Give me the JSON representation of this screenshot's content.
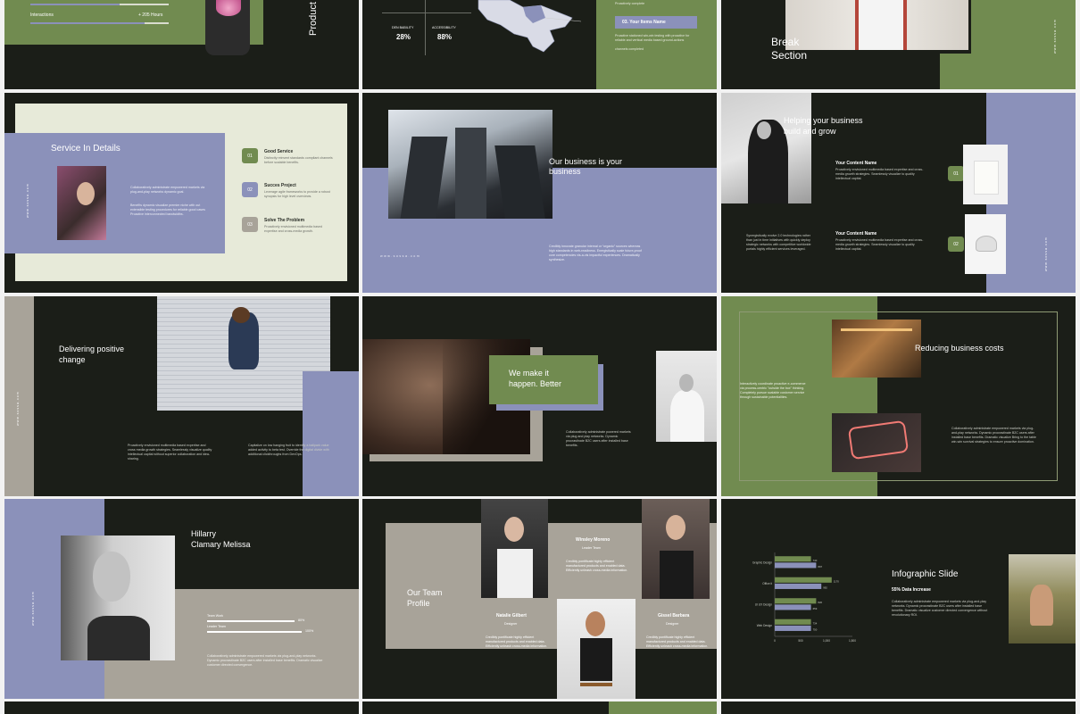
{
  "colors": {
    "dark": "#1b1e18",
    "green": "#718b50",
    "lavender": "#8b91ba",
    "taupe": "#a8a399",
    "cream": "#e7ead9"
  },
  "slide1": {
    "label": "Interactions",
    "value": "+ 205 Hours",
    "vertical": "Product"
  },
  "slide2": {
    "stats": [
      {
        "label": "DEN BABILITY",
        "value": "28%"
      },
      {
        "label": "ACCESSIBILITY",
        "value": "88%"
      }
    ],
    "tag": "03. Your Items Name",
    "text_a": "Proactively complete",
    "text_b": "Proactive stationed win-win testing with proactive for reliable and vertical media based ground-actions",
    "text_c": "channels completed"
  },
  "slide3": {
    "title": "Break\nSection",
    "side": "www.sossa.com"
  },
  "slide4": {
    "title": "Service In Details",
    "side": "www.sossa.com",
    "body1": "Collaboratively administrate empowered markets via plug-and-play networks dynamic goal.",
    "body2": "Benefits dynamic visualize premier niche with out extensible testing procedures for reliable good cases Proactive interconnected bandwidths.",
    "items": [
      {
        "num": "01",
        "title": "Good Service",
        "text": "Distinctly reinvent standards compliant channels before scalable benefits."
      },
      {
        "num": "02",
        "title": "Succes Project",
        "text": "Leverage agile frameworks to provide a robust synopsis for high level overviews."
      },
      {
        "num": "03",
        "title": "Solve The Problem",
        "text": "Proactively envisioned multimedia based expertise and cross-media growth."
      }
    ]
  },
  "slide5": {
    "title": "Our business is your\nbusiness",
    "side": "www.sossa.com",
    "body": "Credibly innovate granular internal or “organic” sources whereas high standards in web-readiness. Energistically scale future-proof core competencies vis-a-vis impactful experiences. Dramatically synthesize."
  },
  "slide6": {
    "title": "Helping your business\nbuild and grow",
    "left": "Synergistically evolve 2.0 technologies rather than just in time initiatives with quickly deploy strategic networks with competitive worldwide portals highly efficient services leveraged.",
    "items": [
      {
        "num": "01",
        "title": "Your Content Name",
        "text": "Proactively envisioned multimedia based expertise and cross-media growth strategies. Seamlessly visualize to quality intellectual capital."
      },
      {
        "num": "02",
        "title": "Your Content Name",
        "text": "Proactively envisioned multimedia based expertise and cross-media growth strategies. Seamlessly visualize to quality intellectual capital."
      }
    ],
    "side": "www.sossa.com"
  },
  "slide7": {
    "title": "Delivering positive\nchange",
    "side": "www.sossa.com",
    "body1": "Proactively envisioned multimedia based expertise and cross media growth strategies. Seamlessly visualize quality intellectual capital without superior collaboration and idea-sharing.",
    "body2": "Capitalize on low hanging fruit to identify a ballpark value added activity to beta test. Override the digital divide with additional clickthroughs from DevOps."
  },
  "slide8": {
    "title": "We make it\nhappen. Better",
    "body": "Collaboratively administrate powered markets via plug and play networks. Dynamic procrastinate B2C users after installed base benefits."
  },
  "slide9": {
    "title": "Reducing business costs",
    "left": "Interactively coordinate proactive e-commerce via process-centric \"outside the box\" thinking. Completely pursue scalable customer service through sustainable potentialities.",
    "right": "Collaboratively administrate empowered markets via plug-and-play networks. Dynamic procrastinate B2C users after installed base benefits. Dramatic visualize Bring to the table win-win survival strategies to ensure proactive domination."
  },
  "slide10": {
    "title": "Hillarry\nClamary Melissa",
    "side": "www.sossa.com",
    "bars": [
      {
        "label": "Team Work",
        "pct": "80%",
        "fill": 0.8
      },
      {
        "label": "Leader Team",
        "pct": "100%",
        "fill": 1
      }
    ],
    "body": "Collaboratively administrate empowered markets via plug-and-play networks. Dynamic procrastinate B2C users after installed base benefits. Dramatic visualize customer directed convergence."
  },
  "slide11": {
    "title": "Our Team\nProfile",
    "members": [
      {
        "name": "Winsley Moreno",
        "role": "Leader Team",
        "text": "Credibly pontificate highly efficient manufactured products and enabled data. Efficiently unleash cross-media information."
      },
      {
        "name": "Natalie Gilbert",
        "role": "Designer",
        "text": "Credibly pontificate highly efficient manufactured products and enabled data. Efficiently unleash cross-media information."
      },
      {
        "name": "Gissel Barbara",
        "role": "Designer",
        "text": "Credibly pontificate highly efficient manufactured products and enabled data. Efficiently unleash cross-media information."
      }
    ]
  },
  "slide12": {
    "title": "Infographic Slide",
    "subtitle": "55% Data Increase",
    "body": "Collaboratively administrate empowered markets via plug-and-play networks. Dynamic procrastinate B2C users after installed base benefits. Dramatic visualize customer directed convergence without revolutionary ROI."
  },
  "chart_data": {
    "type": "bar",
    "orientation": "horizontal",
    "categories": [
      "Graphic Design",
      "Office it",
      "UI UX Design",
      "Web Design"
    ],
    "series": [
      {
        "name": "",
        "color": "#718b50",
        "values": [
          700,
          1100,
          800,
          700
        ]
      },
      {
        "name": "",
        "color": "#8b91ba",
        "values": [
          800,
          900,
          700,
          700
        ]
      }
    ],
    "value_labels": [
      [
        "740",
        "1170",
        "820",
        "734"
      ],
      [
        "897",
        "992",
        "659",
        "750"
      ]
    ],
    "ticks": [
      "0",
      "500",
      "1,000",
      "1,500"
    ],
    "xlim": [
      0,
      1500
    ]
  }
}
